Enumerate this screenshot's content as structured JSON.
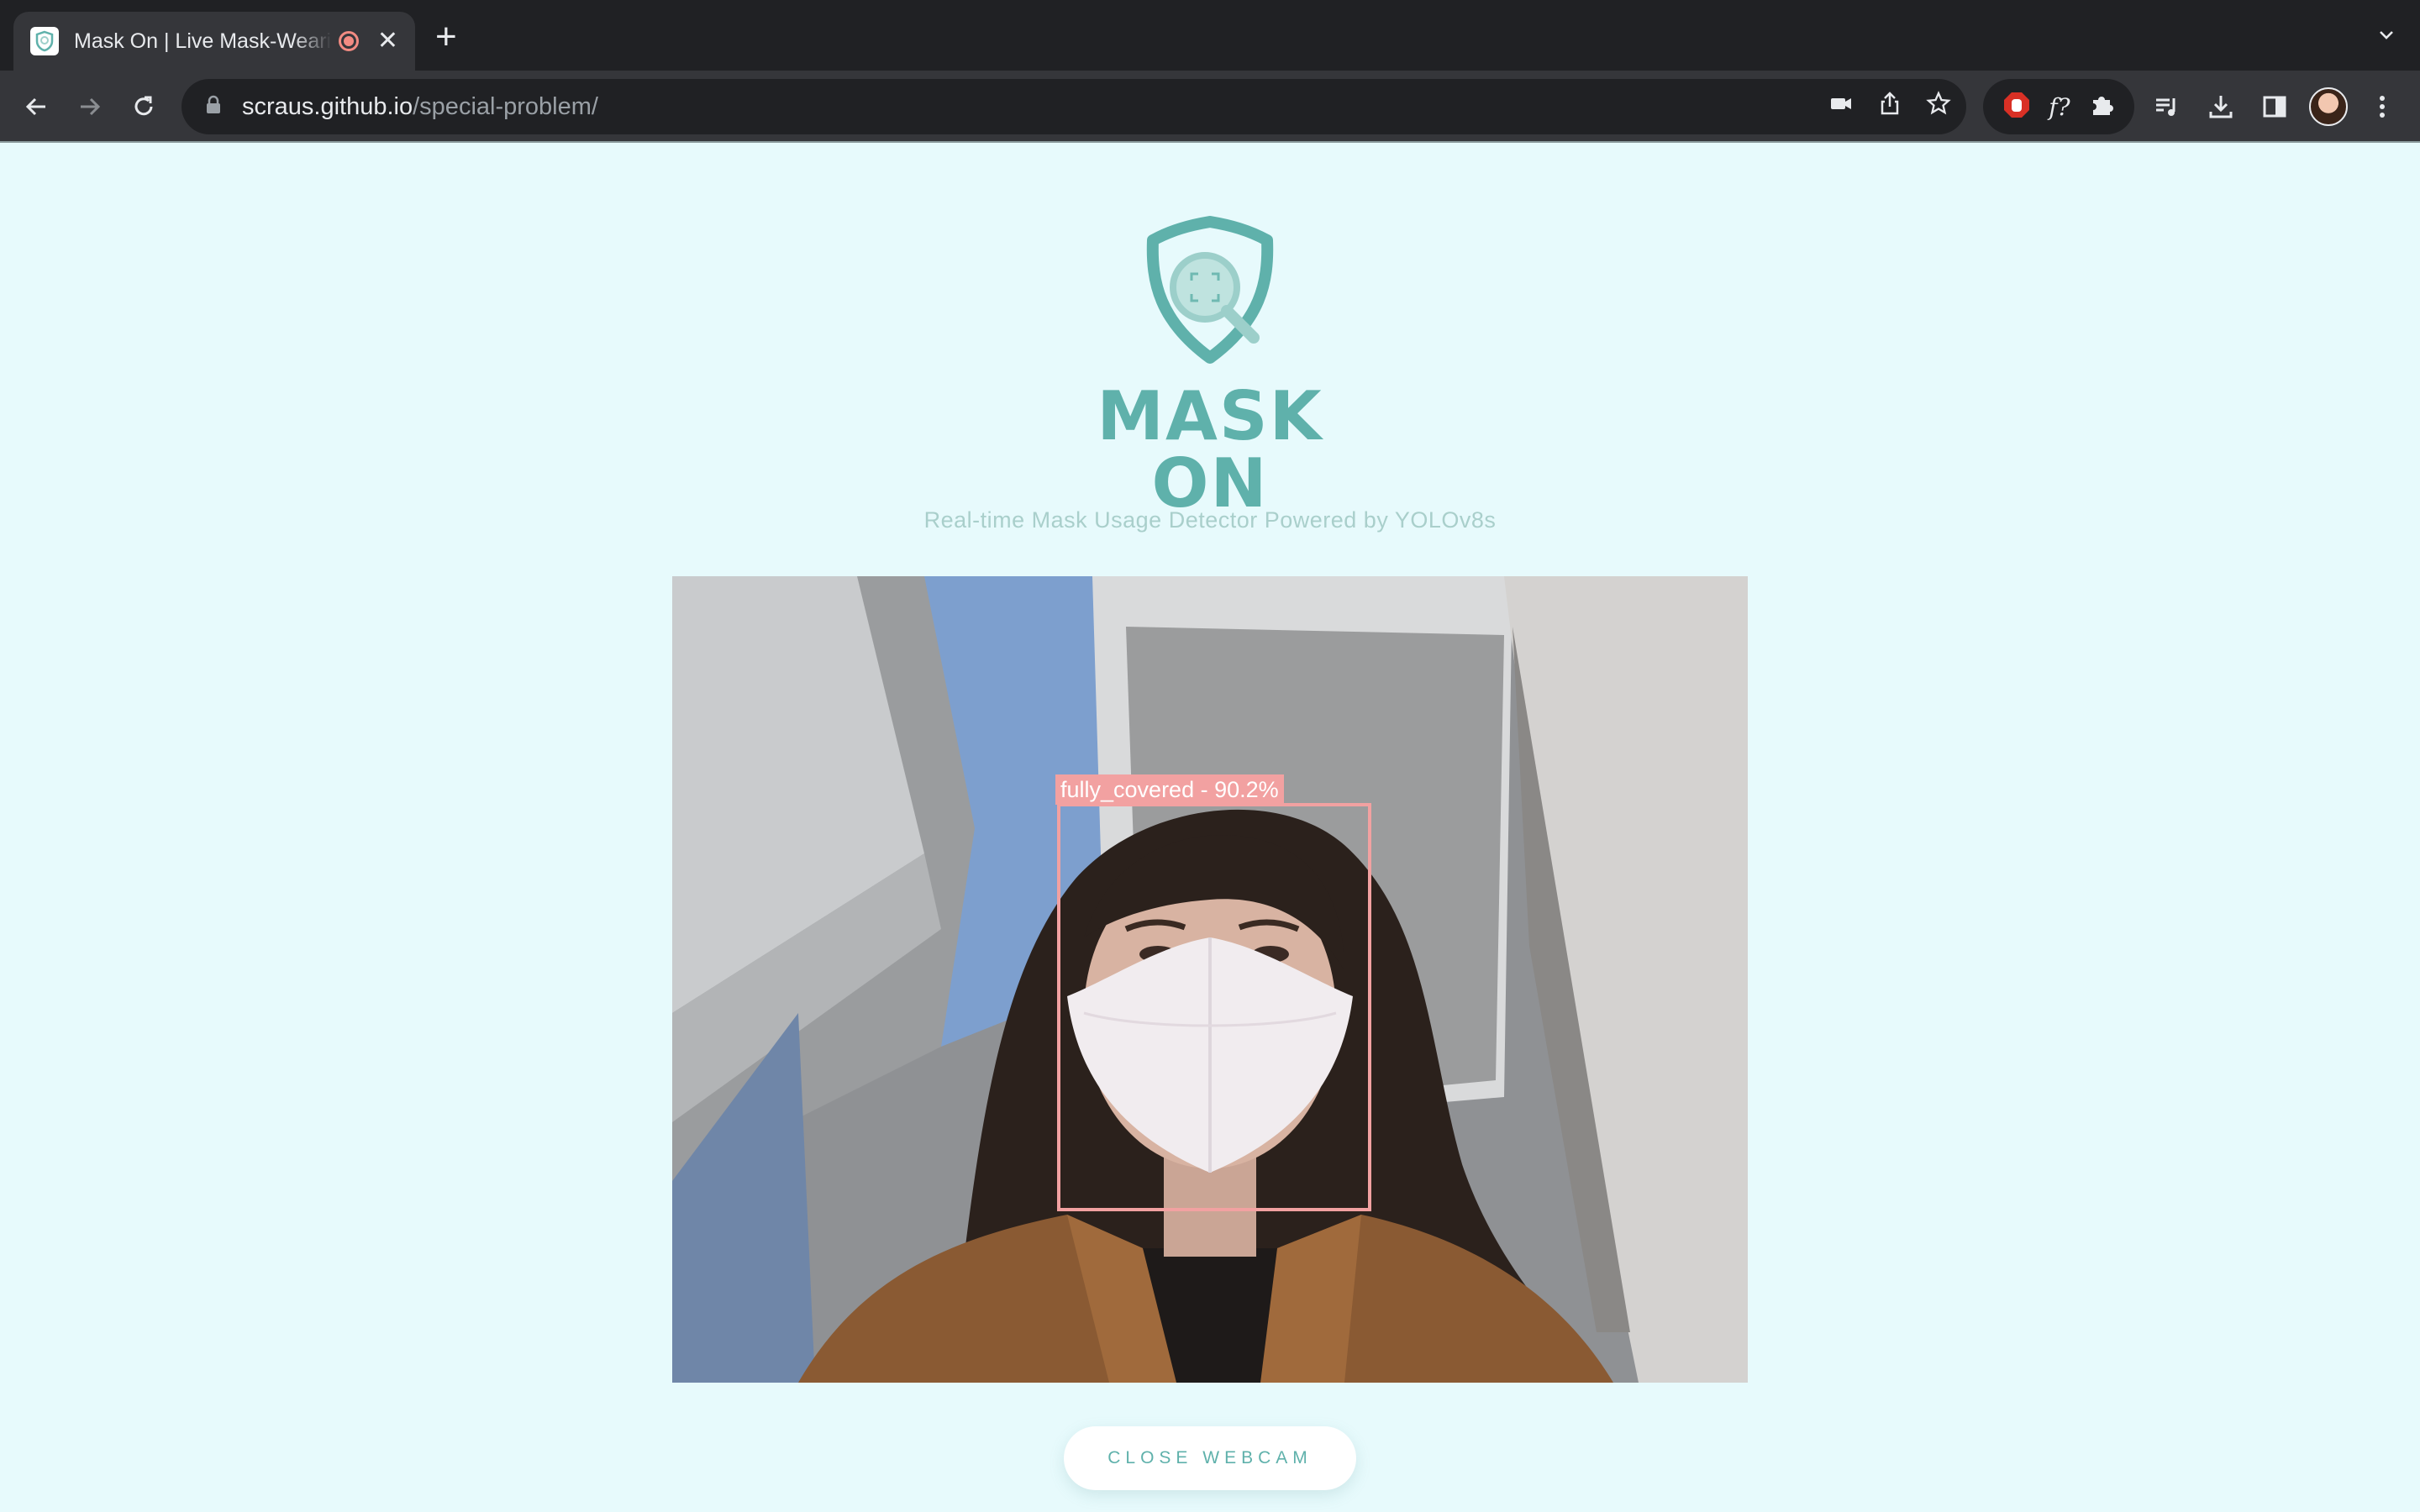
{
  "browser": {
    "tab": {
      "title": "Mask On | Live Mask-Wearing Detector",
      "favicon": "shield-icon",
      "recording_indicator": "recording-icon"
    },
    "url": {
      "host": "scraus.github.io",
      "path": "/special-problem/"
    },
    "toolbar_icons": [
      "back-icon",
      "forward-icon",
      "reload-icon",
      "lock-icon",
      "camera-icon",
      "share-icon",
      "star-icon",
      "adblock-icon",
      "formula-icon",
      "puzzle-icon",
      "media-queue-icon",
      "download-icon",
      "side-panel-icon",
      "avatar",
      "kebab-menu-icon"
    ],
    "extension_formula_label": "f?"
  },
  "page": {
    "logo_text": "MASK ON",
    "tagline": "Real-time Mask Usage Detector Powered by YOLOv8s",
    "webcam": {
      "detection": {
        "label": "fully_covered - 90.2%",
        "class": "fully_covered",
        "confidence_percent": 90.2
      }
    },
    "close_button_label": "CLOSE WEBCAM"
  },
  "colors": {
    "page_background": "#e7fafc",
    "brand_teal": "#5fb1ab",
    "detection_box": "#f2a1a1",
    "chrome_dark": "#202124",
    "chrome_toolbar": "#35363a"
  }
}
